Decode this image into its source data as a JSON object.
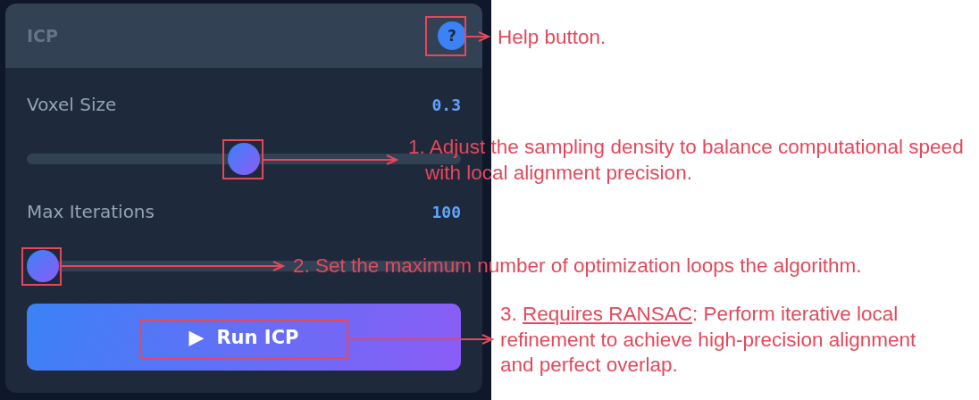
{
  "panel": {
    "title": "ICP",
    "help": "?"
  },
  "sliders": [
    {
      "label": "Voxel Size",
      "value": "0.3",
      "level": 0.5
    },
    {
      "label": "Max Iterations",
      "value": "100",
      "level": 0
    }
  ],
  "run_button": {
    "icon": "▶",
    "label": "Run ICP"
  },
  "callouts": [
    {
      "kind": "plain",
      "text": "Help button."
    },
    {
      "kind": "plain",
      "text": "1. Adjust the sampling density to balance computational speed with local alignment precision."
    },
    {
      "kind": "plain",
      "text": "2. Set the maximum number of optimization loops the algorithm."
    },
    {
      "kind": "linked",
      "number": "3.",
      "link": "Requires RANSAC",
      "text": ": Perform iterative local refinement to achieve high-precision alignment and perfect overlap."
    }
  ]
}
